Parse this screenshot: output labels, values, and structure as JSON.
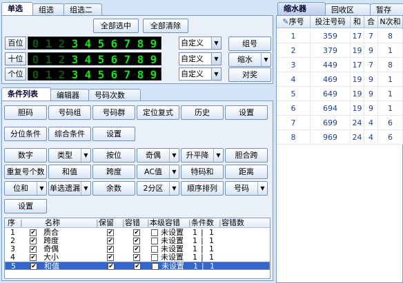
{
  "top_tabs": [
    "单选",
    "组选",
    "组选二"
  ],
  "select_all": "全部选中",
  "clear_all": "全部清除",
  "rows": [
    {
      "label": "百位",
      "custom": "自定义"
    },
    {
      "label": "十位",
      "custom": "自定义"
    },
    {
      "label": "个位",
      "custom": "自定义"
    }
  ],
  "digits": [
    "0",
    "1",
    "2",
    "3",
    "4",
    "5",
    "6",
    "7",
    "8",
    "9"
  ],
  "digit_states": [
    [
      false,
      false,
      false,
      true,
      true,
      true,
      true,
      true,
      true,
      true
    ],
    [
      false,
      false,
      false,
      true,
      true,
      true,
      true,
      true,
      true,
      true
    ],
    [
      false,
      false,
      false,
      true,
      true,
      true,
      true,
      true,
      true,
      true
    ]
  ],
  "right_buttons": {
    "group_no": "组号",
    "shrink": "缩水",
    "prize": "对奖"
  },
  "mid_tabs": [
    "条件列表",
    "编辑器",
    "号码次数"
  ],
  "btn_row1": [
    "胆码",
    "号码组",
    "号码群",
    "定位复式",
    "历史",
    "设置"
  ],
  "btn_row2": [
    "分位条件",
    "综合条件",
    "设置"
  ],
  "btn_row3": [
    "数字",
    "类型",
    "按位",
    "奇偶",
    "升平降",
    "胆合跨"
  ],
  "btn_row4": [
    "重复号个数",
    "和值",
    "跨度",
    "AC值",
    "特码和",
    "距离"
  ],
  "btn_row5": [
    "位和",
    "单选遗漏",
    "余数",
    "2分区",
    "顺序排列",
    "号码"
  ],
  "btn_row6": [
    "设置"
  ],
  "list_headers": [
    "序",
    "",
    "名称",
    "保留",
    "容错",
    "本级容错",
    "条件数",
    "容错数"
  ],
  "list_rows": [
    {
      "no": "1",
      "name": "质合",
      "status": "未设置",
      "cond": "1",
      "tol": "1"
    },
    {
      "no": "2",
      "name": "跨度",
      "status": "未设置",
      "cond": "1",
      "tol": "1"
    },
    {
      "no": "3",
      "name": "奇偶",
      "status": "未设置",
      "cond": "1",
      "tol": "1"
    },
    {
      "no": "4",
      "name": "大小",
      "status": "未设置",
      "cond": "1",
      "tol": "1"
    },
    {
      "no": "5",
      "name": "和值",
      "status": "未设置",
      "cond": "1",
      "tol": "1"
    }
  ],
  "right_tabs": [
    "缩水器",
    "回收区",
    "暂存"
  ],
  "table_headers": [
    "序号",
    "投注号码",
    "和",
    "合",
    "N次和"
  ],
  "table_rows": [
    [
      "1",
      "359",
      "17",
      "7",
      "8"
    ],
    [
      "2",
      "379",
      "19",
      "9",
      "1"
    ],
    [
      "3",
      "449",
      "17",
      "7",
      "8"
    ],
    [
      "4",
      "469",
      "19",
      "9",
      "1"
    ],
    [
      "5",
      "649",
      "19",
      "9",
      "1"
    ],
    [
      "6",
      "694",
      "19",
      "9",
      "1"
    ],
    [
      "7",
      "699",
      "24",
      "4",
      "6"
    ],
    [
      "8",
      "969",
      "24",
      "4",
      "6"
    ]
  ]
}
